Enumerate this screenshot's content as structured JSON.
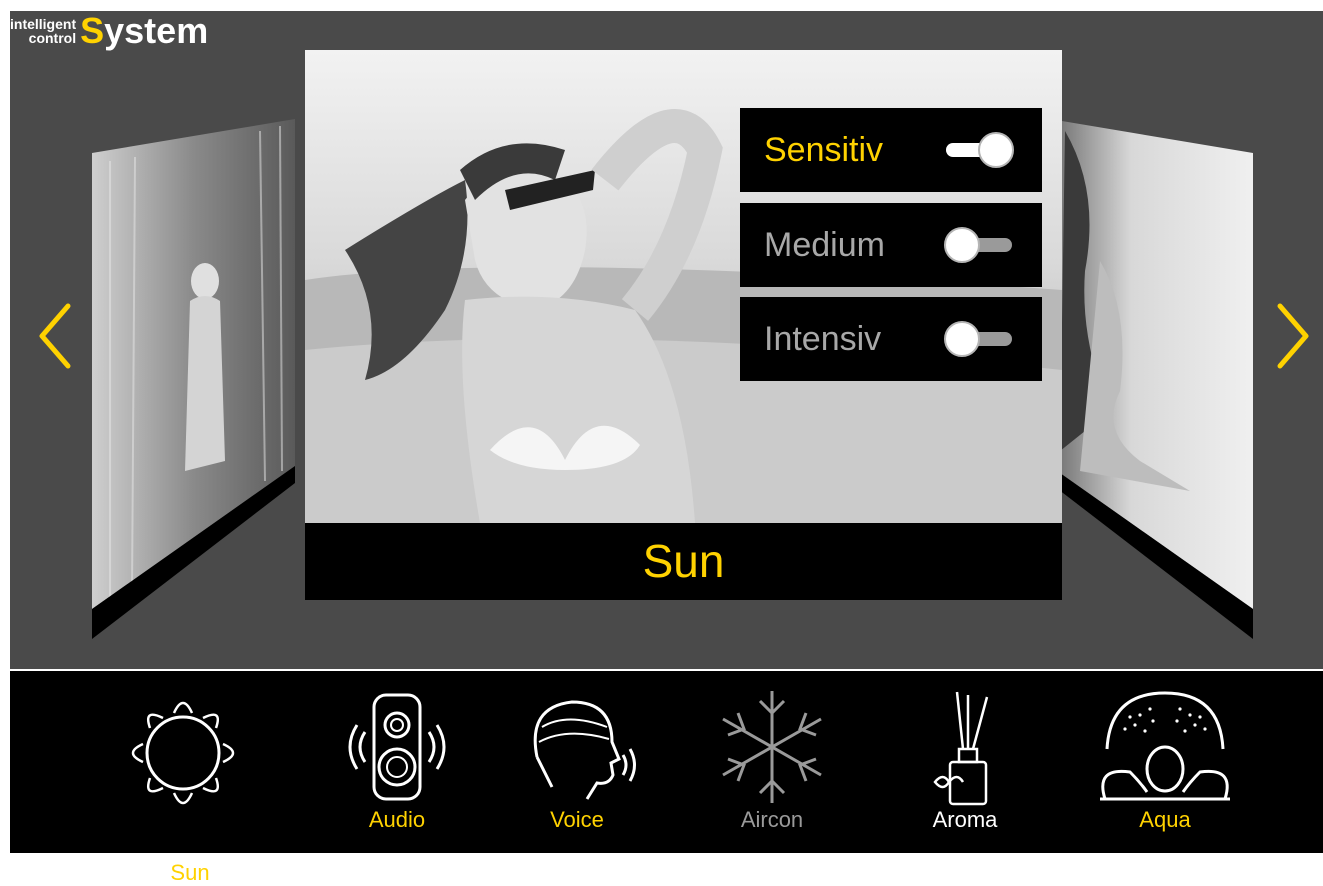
{
  "logo": {
    "line1": "intelligent",
    "line2": "control",
    "first_letter": "S",
    "rest": "ystem"
  },
  "main_card": {
    "title": "Sun"
  },
  "options": [
    {
      "label": "Sensitiv",
      "state": "on"
    },
    {
      "label": "Medium",
      "state": "off"
    },
    {
      "label": "Intensiv",
      "state": "off"
    }
  ],
  "dock": {
    "items": [
      {
        "label": "",
        "icon": "sun-icon"
      },
      {
        "label": "Audio",
        "icon": "speaker-icon"
      },
      {
        "label": "Voice",
        "icon": "voice-icon"
      },
      {
        "label": "Aircon",
        "icon": "snowflake-icon"
      },
      {
        "label": "Aroma",
        "icon": "aroma-icon"
      },
      {
        "label": "Aqua",
        "icon": "aqua-icon"
      }
    ],
    "selected_label": "Sun"
  },
  "colors": {
    "accent": "#ffd200",
    "stage": "#4a4a4a",
    "dock": "#000000",
    "disabled": "#9a9a9a"
  }
}
